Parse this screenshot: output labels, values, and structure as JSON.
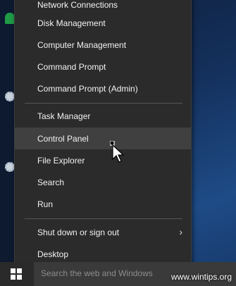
{
  "menu": {
    "items": [
      {
        "label": "Network Connections"
      },
      {
        "label": "Disk Management"
      },
      {
        "label": "Computer Management"
      },
      {
        "label": "Command Prompt"
      },
      {
        "label": "Command Prompt (Admin)"
      },
      {
        "label": "Task Manager"
      },
      {
        "label": "Control Panel"
      },
      {
        "label": "File Explorer"
      },
      {
        "label": "Search"
      },
      {
        "label": "Run"
      },
      {
        "label": "Shut down or sign out"
      },
      {
        "label": "Desktop"
      }
    ],
    "hovered": "Control Panel",
    "submenu_chevron": "chevron-right-icon"
  },
  "taskbar": {
    "search_placeholder": "Search the web and Windows",
    "start_icon": "windows-logo-icon"
  },
  "watermark": "www.wintips.org",
  "colors": {
    "menu_bg": "#2b2b2b",
    "hover_bg": "#404040",
    "text": "#f2f2f2"
  }
}
